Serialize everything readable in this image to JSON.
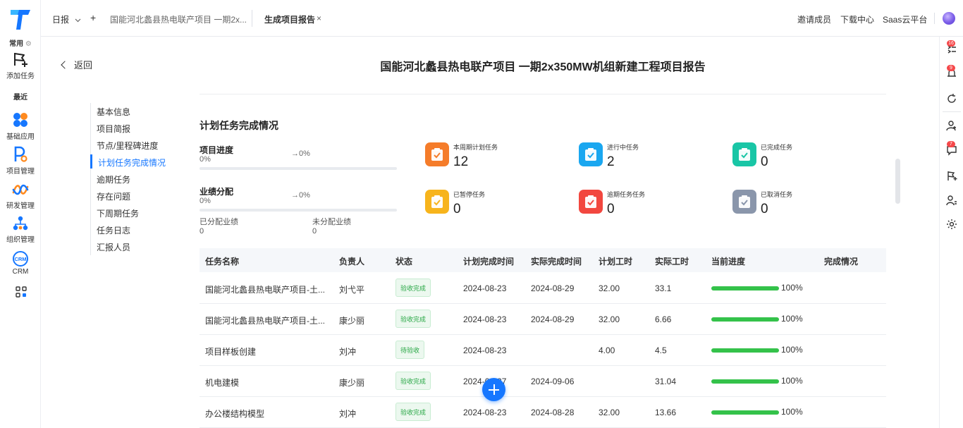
{
  "leftnav": {
    "common_label": "常用",
    "add_task_label": "添加任务",
    "recent_label": "最近",
    "apps": [
      {
        "label": "基础应用",
        "icon": "four-dots-icon"
      },
      {
        "label": "项目管理",
        "icon": "project-icon"
      },
      {
        "label": "研发管理",
        "icon": "infinity-icon"
      },
      {
        "label": "组织管理",
        "icon": "org-tree-icon"
      },
      {
        "label": "CRM",
        "icon": "crm-icon"
      }
    ]
  },
  "topbar": {
    "daily_label": "日报",
    "add_label": "+",
    "tab_project": "国能河北蠡县热电联产项目 一期2x...",
    "tab_report": "生成项目报告",
    "tab_close": "×",
    "invite_label": "邀请成员",
    "download_label": "下载中心",
    "saas_label": "Saas云平台"
  },
  "rightrail": {
    "badges": [
      "16",
      "9",
      "7"
    ]
  },
  "page": {
    "back_label": "返回",
    "title": "国能河北蠡县热电联产项目 一期2x350MW机组新建工程项目报告"
  },
  "toc": {
    "items": [
      "基本信息",
      "项目简报",
      "节点/里程碑进度",
      "计划任务完成情况",
      "逾期任务",
      "存在问题",
      "下周期任务",
      "任务日志",
      "汇报人员"
    ],
    "active_index": 3
  },
  "section": {
    "title": "计划任务完成情况",
    "progress_label": "项目进度",
    "progress_value": "0%",
    "progress_arrow": "→0%",
    "progress_fraction": 0,
    "performance_label": "业绩分配",
    "performance_value": "0%",
    "performance_arrow": "→0%",
    "performance_fraction": 0,
    "allocated_label": "已分配业绩",
    "allocated_value": "0",
    "unallocated_label": "未分配业绩",
    "unallocated_value": "0"
  },
  "stats": [
    {
      "label": "本周期计划任务",
      "value": "12",
      "color": "#f57c2a"
    },
    {
      "label": "进行中任务",
      "value": "2",
      "color": "#1aa7f0"
    },
    {
      "label": "已完成任务",
      "value": "0",
      "color": "#19c6a6"
    },
    {
      "label": "已暂停任务",
      "value": "0",
      "color": "#f7b41c"
    },
    {
      "label": "逾期任务任务",
      "value": "0",
      "color": "#f2473f"
    },
    {
      "label": "已取消任务",
      "value": "0",
      "color": "#8a96ab"
    }
  ],
  "table": {
    "headers": [
      "任务名称",
      "负责人",
      "状态",
      "计划完成时间",
      "实际完成时间",
      "计划工时",
      "实际工时",
      "当前进度",
      "完成情况"
    ],
    "rows": [
      {
        "name": "国能河北蠡县热电联产项目-土...",
        "owner": "刘弋平",
        "status": "验收完成",
        "plan_date": "2024-08-23",
        "actual_date": "2024-08-29",
        "plan_hours": "32.00",
        "actual_hours": "33.1",
        "progress": "100%",
        "progress_fraction": 1
      },
      {
        "name": "国能河北蠡县热电联产项目-土...",
        "owner": "康少丽",
        "status": "验收完成",
        "plan_date": "2024-08-23",
        "actual_date": "2024-08-29",
        "plan_hours": "32.00",
        "actual_hours": "6.66",
        "progress": "100%",
        "progress_fraction": 1
      },
      {
        "name": "项目样板创建",
        "owner": "刘冲",
        "status": "待验收",
        "plan_date": "2024-08-23",
        "actual_date": "",
        "plan_hours": "4.00",
        "actual_hours": "4.5",
        "progress": "100%",
        "progress_fraction": 1
      },
      {
        "name": "机电建模",
        "owner": "康少丽",
        "status": "验收完成",
        "plan_date": "2024-08-27",
        "actual_date": "2024-09-06",
        "plan_hours": "",
        "actual_hours": "31.04",
        "progress": "100%",
        "progress_fraction": 1
      },
      {
        "name": "办公楼结构模型",
        "owner": "刘冲",
        "status": "验收完成",
        "plan_date": "2024-08-23",
        "actual_date": "2024-08-28",
        "plan_hours": "32.00",
        "actual_hours": "13.66",
        "progress": "100%",
        "progress_fraction": 1
      }
    ]
  },
  "colors": {
    "accent": "#1677ff",
    "success": "#34c24a",
    "badge": "#f5484a"
  }
}
